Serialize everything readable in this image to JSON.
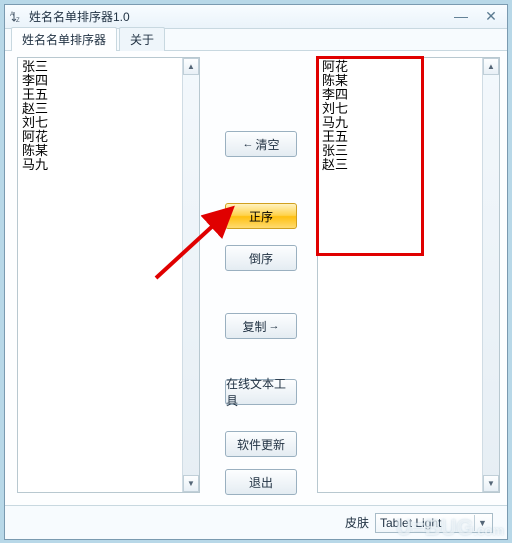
{
  "window": {
    "title": "姓名名单排序器1.0",
    "icon_label": "A→Z"
  },
  "tabs": {
    "main": "姓名名单排序器",
    "about": "关于"
  },
  "input_text": "张三\n李四\n王五\n赵三\n刘七\n阿花\n陈某\n马九",
  "output_text": "阿花\n陈某\n李四\n刘七\n马九\n王五\n张三\n赵三",
  "buttons": {
    "clear": "清空",
    "asc": "正序",
    "desc": "倒序",
    "copy": "复制",
    "tool": "在线文本工具",
    "update": "软件更新",
    "exit": "退出"
  },
  "footer": {
    "skin_label": "皮肤",
    "skin_value": "Tablet Light"
  },
  "watermark": "U=BUG",
  "watermark_suffix": ".com"
}
